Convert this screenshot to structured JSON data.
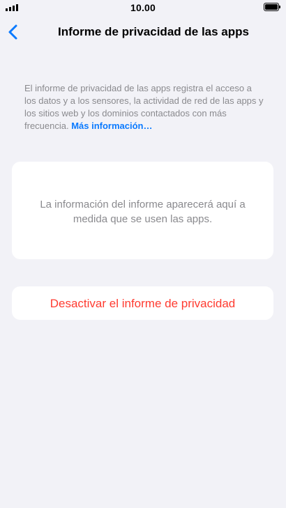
{
  "status_bar": {
    "time": "10.00",
    "signal_icon": "cellular-signal-icon",
    "battery_icon": "battery-icon"
  },
  "nav": {
    "back_icon": "chevron-left-icon",
    "title": "Informe de privacidad de las apps"
  },
  "description": {
    "text": "El informe de privacidad de las apps registra el acceso a los datos y a los sensores, la actividad de red de las apps y los sitios web y los dominios contactados con más frecuencia. ",
    "link": "Más información…"
  },
  "info_card": {
    "text": "La información del informe aparecerá aquí a medida que se usen las apps."
  },
  "action": {
    "label": "Desactivar el informe de privacidad"
  },
  "colors": {
    "background": "#f2f2f7",
    "card": "#ffffff",
    "accent": "#0a7aff",
    "destructive": "#ff3b30",
    "secondary_text": "#8a8a8e"
  }
}
